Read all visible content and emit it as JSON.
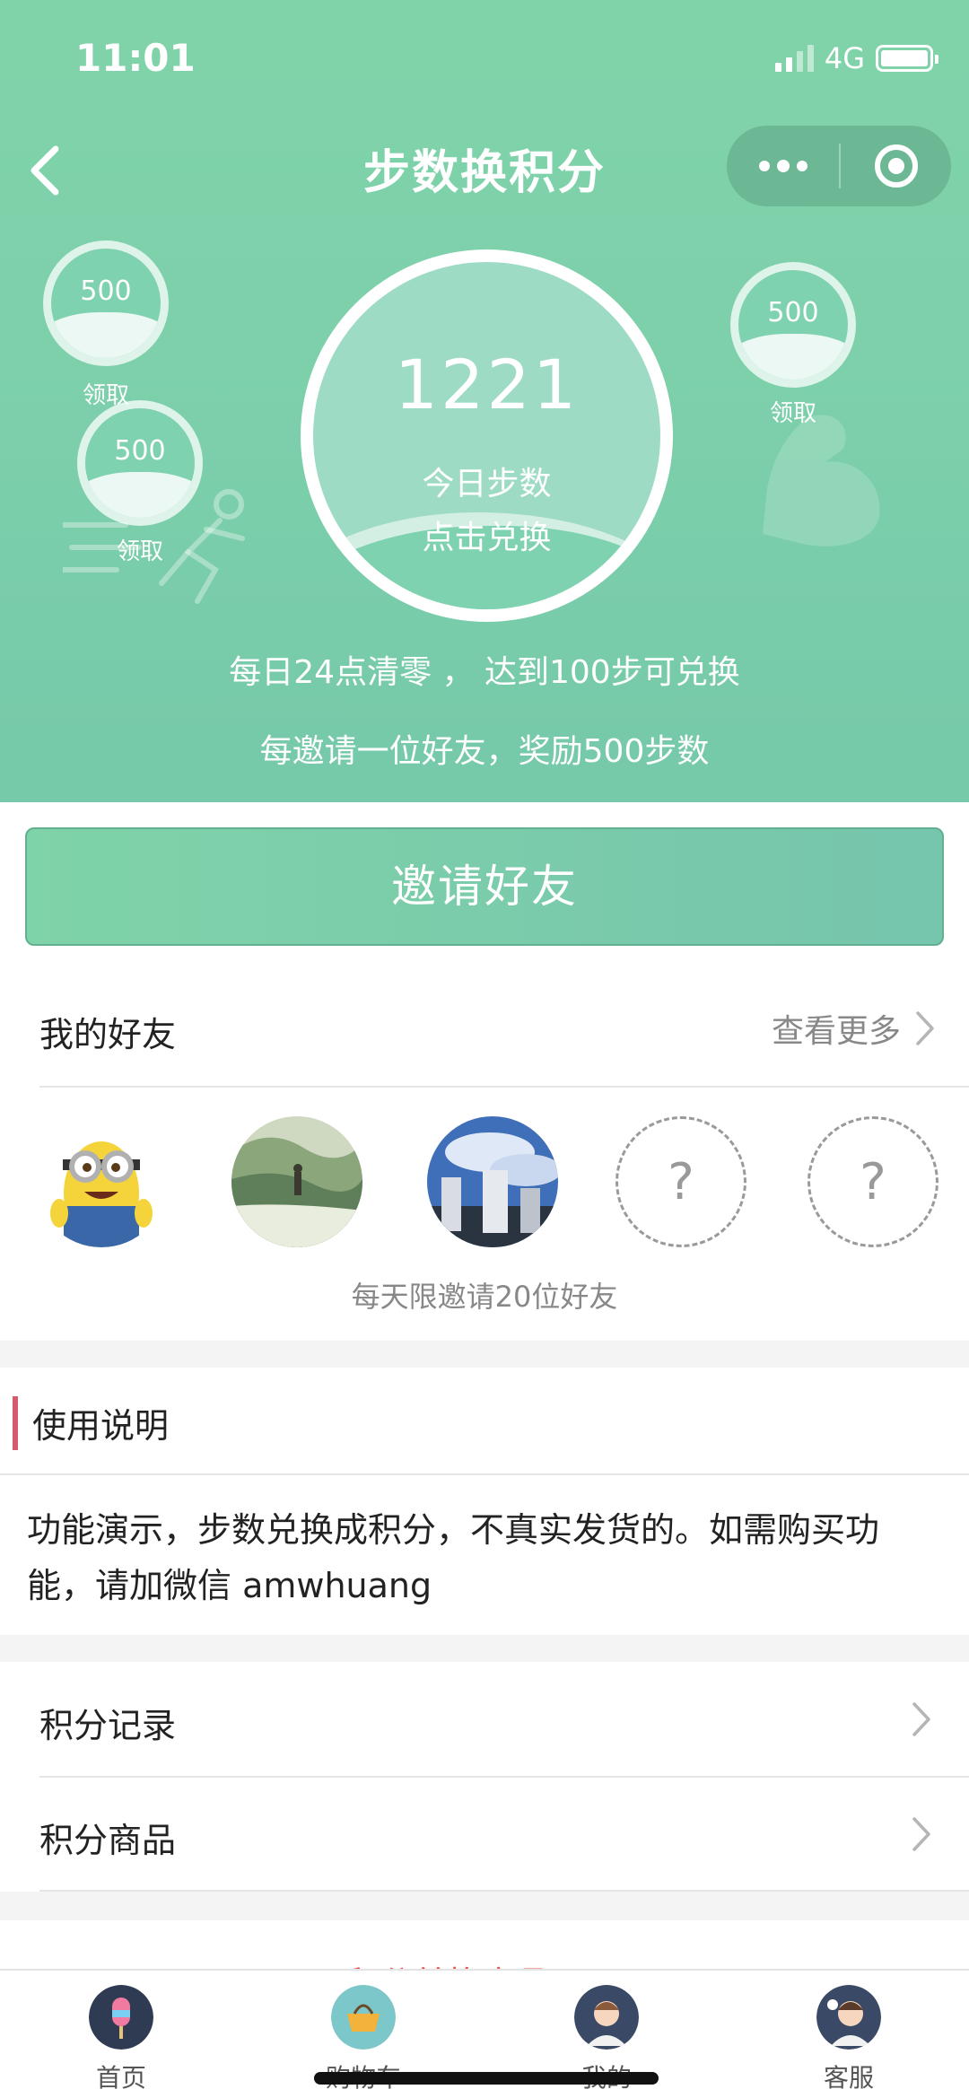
{
  "status": {
    "time": "11:01",
    "network": "4G"
  },
  "header": {
    "title": "步数换积分"
  },
  "bubbles": [
    {
      "value": "500",
      "label": "领取"
    },
    {
      "value": "500",
      "label": "领取"
    },
    {
      "value": "500",
      "label": "领取"
    }
  ],
  "steps": {
    "count": "1221",
    "label": "今日步数",
    "action": "点击兑换"
  },
  "rules": {
    "line1": "每日24点清零 ， 达到100步可兑换",
    "line2": "每邀请一位好友，奖励500步数"
  },
  "invite": {
    "label": "邀请好友"
  },
  "friends": {
    "title": "我的好友",
    "see_more": "查看更多",
    "empty_mark": "?",
    "limit_text": "每天限邀请20位好友"
  },
  "usage": {
    "title": "使用说明",
    "text": "功能演示，步数兑换成积分，不真实发货的。如需购买功能，请加微信 amwhuang"
  },
  "links": [
    {
      "label": "积分记录"
    },
    {
      "label": "积分商品"
    }
  ],
  "teaser": {
    "label": "积分兑换商品"
  },
  "tabbar": [
    {
      "label": "首页",
      "icon": "popsicle-icon"
    },
    {
      "label": "购物车",
      "icon": "basket-icon"
    },
    {
      "label": "我的",
      "icon": "user-avatar-icon"
    },
    {
      "label": "客服",
      "icon": "service-avatar-icon"
    }
  ],
  "colors": {
    "primary": "#7fd3a8",
    "accent_bar": "#d65a6e",
    "teaser_red": "#e7564b"
  }
}
